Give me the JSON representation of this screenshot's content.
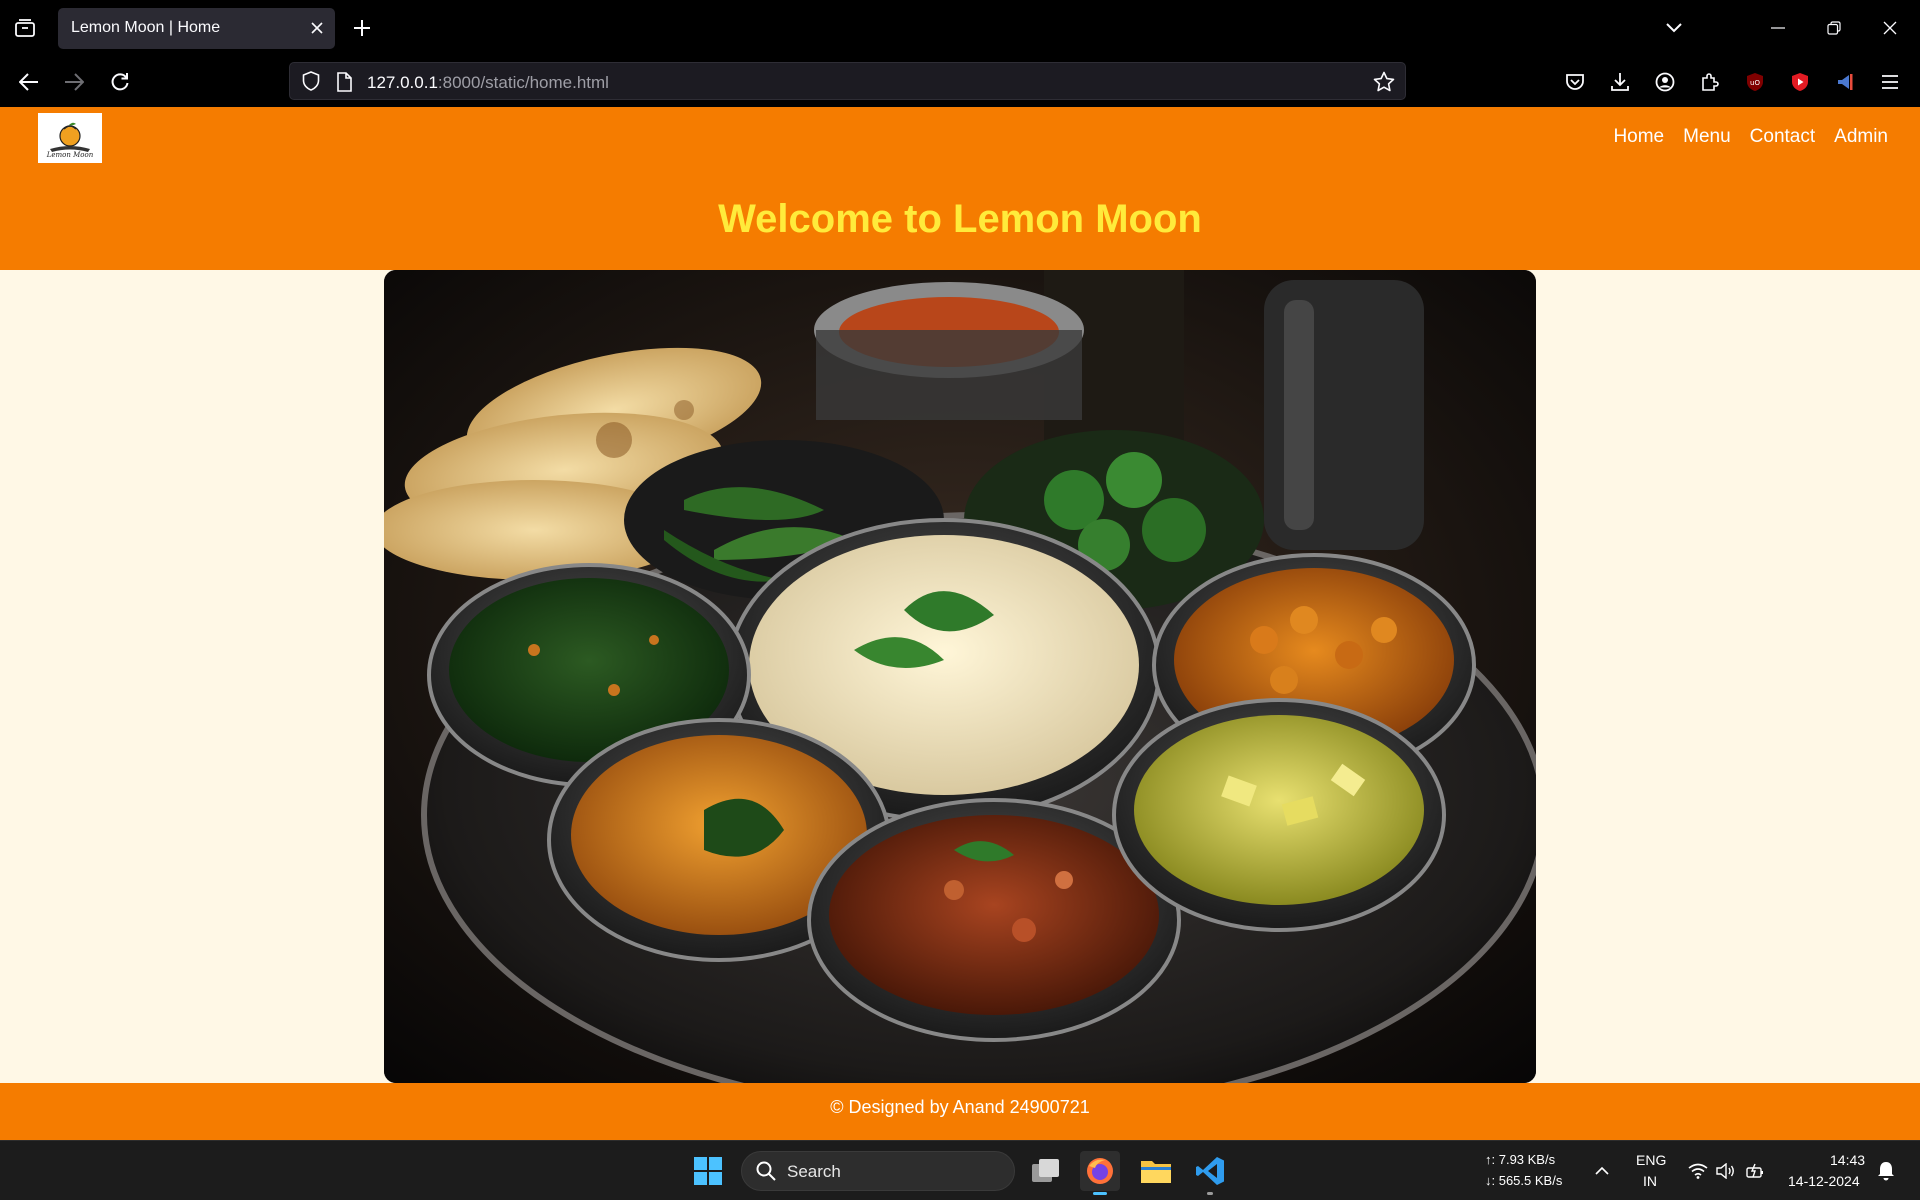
{
  "browser": {
    "tab_title": "Lemon Moon | Home",
    "url_host": "127.0.0.1",
    "url_rest": ":8000/static/home.html"
  },
  "site": {
    "logo_text": "Lemon Moon",
    "nav": [
      "Home",
      "Menu",
      "Contact",
      "Admin"
    ],
    "title": "Welcome to Lemon Moon",
    "footer": "© Designed by Anand 24900721"
  },
  "taskbar": {
    "search_label": "Search",
    "net_up": "↑: 7.93 KB/s",
    "net_down": "↓: 565.5 KB/s",
    "lang_1": "ENG",
    "lang_2": "IN",
    "time": "14:43",
    "date": "14-12-2024"
  },
  "colors": {
    "brand_orange": "#f57c00",
    "title_yellow": "#ffeb3b",
    "page_bg": "#fff8e6"
  }
}
